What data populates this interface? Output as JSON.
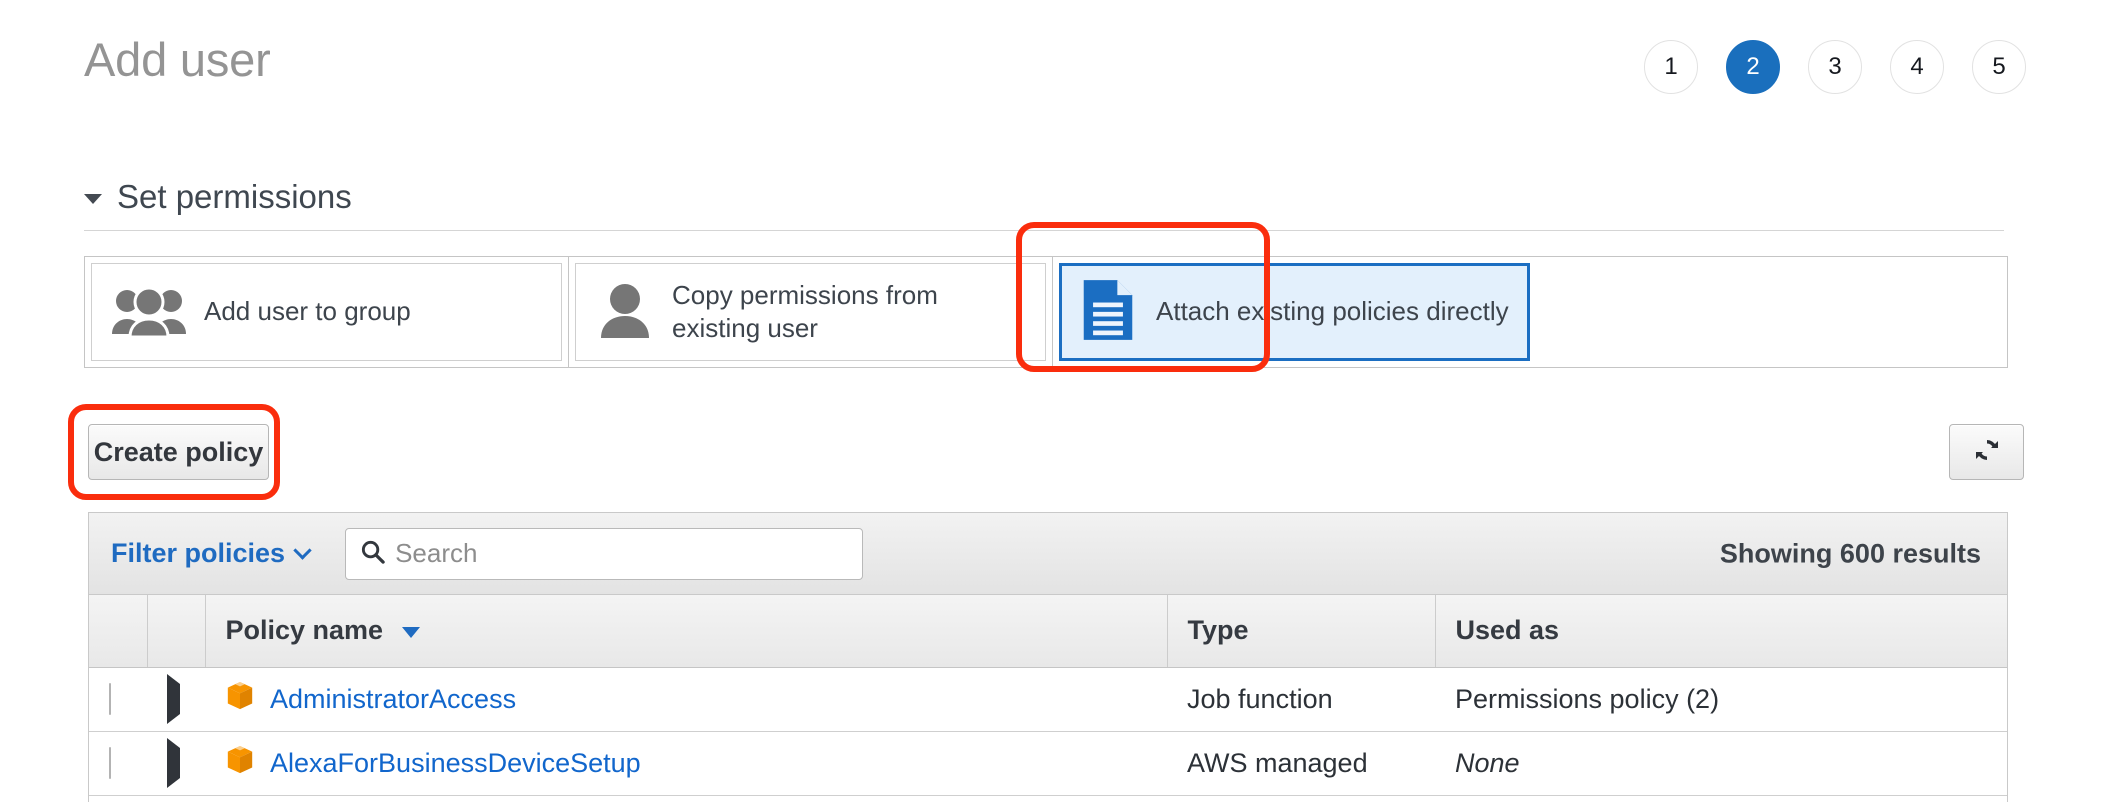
{
  "header": {
    "title": "Add user",
    "steps": [
      {
        "label": "1",
        "active": false
      },
      {
        "label": "2",
        "active": true
      },
      {
        "label": "3",
        "active": false
      },
      {
        "label": "4",
        "active": false
      },
      {
        "label": "5",
        "active": false
      }
    ]
  },
  "permissions_section": {
    "title": "Set permissions",
    "collapse_icon": "caret-down-icon",
    "options": [
      {
        "label": "Add user to group",
        "icon": "user-group-icon",
        "selected": false
      },
      {
        "label": "Copy permissions from existing user",
        "icon": "user-icon",
        "selected": false
      },
      {
        "label": "Attach existing policies directly",
        "icon": "document-icon",
        "selected": true
      }
    ]
  },
  "actions": {
    "create_policy_label": "Create policy",
    "refresh_icon": "refresh-icon"
  },
  "filter_bar": {
    "filter_label": "Filter policies",
    "filter_chevron": "chevron-down-icon",
    "search_icon": "search-icon",
    "search_value": "",
    "search_placeholder": "Search",
    "results_text": "Showing 600 results"
  },
  "table": {
    "columns": {
      "checkbox": "",
      "expand": "",
      "name": "Policy name",
      "type": "Type",
      "used_as": "Used as"
    },
    "sort_icon": "sort-descending-icon",
    "rows": [
      {
        "checked": false,
        "expand_icon": "triangle-right-icon",
        "policy_icon": "policy-cube-icon",
        "name": "AdministratorAccess",
        "type": "Job function",
        "used_as": "Permissions policy (2)",
        "used_as_muted": false
      },
      {
        "checked": false,
        "expand_icon": "triangle-right-icon",
        "policy_icon": "policy-cube-icon",
        "name": "AlexaForBusinessDeviceSetup",
        "type": "AWS managed",
        "used_as": "None",
        "used_as_muted": true
      }
    ]
  },
  "annotations": [
    {
      "name": "attach-existing-policies-highlight",
      "color": "#fa2d0d"
    },
    {
      "name": "create-policy-highlight",
      "color": "#fa2d0d"
    }
  ],
  "colors": {
    "accent_blue": "#1a6fbd",
    "link_blue": "#1166cc",
    "selected_card_bg": "#e3f0fc",
    "selected_card_border": "#1b6ec2",
    "policy_icon_orange": "#f79400",
    "annotation_red": "#fa2d0d",
    "title_gray": "#949494"
  }
}
